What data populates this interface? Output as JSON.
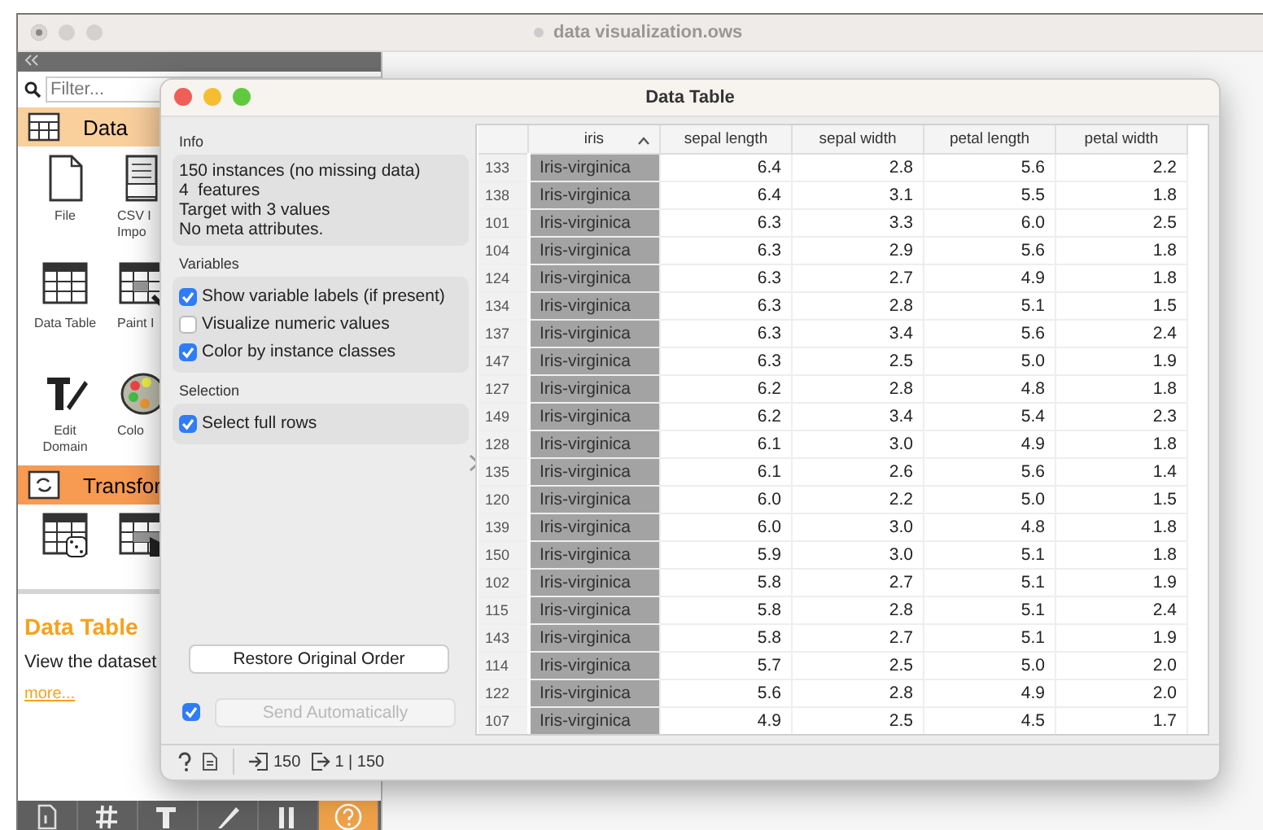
{
  "app_window": {
    "title": "data visualization.ows"
  },
  "sidebar": {
    "filter": {
      "placeholder": "Filter..."
    },
    "categories": [
      {
        "name": "Data",
        "color": "#f9cf9c",
        "kind": "data",
        "widgets": [
          {
            "kind": "file",
            "lines": [
              "File"
            ]
          },
          {
            "kind": "csv",
            "lines": [
              "CSV I",
              "Impo"
            ]
          },
          {
            "kind": "table",
            "lines": [
              "Data Table"
            ]
          },
          {
            "kind": "paint",
            "lines": [
              "Paint I"
            ]
          },
          {
            "kind": "edit",
            "lines": [
              "Edit",
              "Domain"
            ]
          },
          {
            "kind": "palette",
            "lines": [
              "Colo"
            ]
          }
        ]
      },
      {
        "name": "Transfor",
        "color": "#f79a52",
        "kind": "transform",
        "widgets": [
          {
            "kind": "sampler"
          },
          {
            "kind": "select"
          }
        ]
      }
    ],
    "help": {
      "title": "Data Table",
      "description": "View the dataset",
      "link": "more..."
    },
    "toolbar": [
      {
        "kind": "doc",
        "selected": false
      },
      {
        "kind": "hash",
        "selected": false
      },
      {
        "kind": "text",
        "selected": false
      },
      {
        "kind": "pen",
        "selected": false
      },
      {
        "kind": "pause",
        "selected": false
      },
      {
        "kind": "help",
        "selected": true
      }
    ]
  },
  "dialog": {
    "title": "Data Table",
    "info": {
      "heading": "Info",
      "lines": [
        "150 instances (no missing data)",
        "4  features",
        "Target with 3 values",
        "No meta attributes."
      ]
    },
    "variables": {
      "heading": "Variables",
      "options": [
        {
          "label": "Show variable labels (if present)",
          "checked": true
        },
        {
          "label": "Visualize numeric values",
          "checked": false
        },
        {
          "label": "Color by instance classes",
          "checked": true
        }
      ]
    },
    "selection": {
      "heading": "Selection",
      "options": [
        {
          "label": "Select full rows",
          "checked": true
        }
      ]
    },
    "restore_button": "Restore Original Order",
    "auto_send": {
      "checked": true,
      "label": "Send Automatically",
      "disabled": true
    },
    "status_bar": {
      "inputs": "150",
      "outputs": "1 | 150"
    },
    "table": {
      "columns": [
        {
          "label": "iris",
          "sorted": true
        },
        {
          "label": "sepal length",
          "sorted": false
        },
        {
          "label": "sepal width",
          "sorted": false
        },
        {
          "label": "petal length",
          "sorted": false
        },
        {
          "label": "petal width",
          "sorted": false
        }
      ],
      "rows": [
        {
          "index": "133",
          "cells": [
            "Iris-virginica",
            "6.4",
            "2.8",
            "5.6",
            "2.2"
          ]
        },
        {
          "index": "138",
          "cells": [
            "Iris-virginica",
            "6.4",
            "3.1",
            "5.5",
            "1.8"
          ]
        },
        {
          "index": "101",
          "cells": [
            "Iris-virginica",
            "6.3",
            "3.3",
            "6.0",
            "2.5"
          ]
        },
        {
          "index": "104",
          "cells": [
            "Iris-virginica",
            "6.3",
            "2.9",
            "5.6",
            "1.8"
          ]
        },
        {
          "index": "124",
          "cells": [
            "Iris-virginica",
            "6.3",
            "2.7",
            "4.9",
            "1.8"
          ]
        },
        {
          "index": "134",
          "cells": [
            "Iris-virginica",
            "6.3",
            "2.8",
            "5.1",
            "1.5"
          ]
        },
        {
          "index": "137",
          "cells": [
            "Iris-virginica",
            "6.3",
            "3.4",
            "5.6",
            "2.4"
          ]
        },
        {
          "index": "147",
          "cells": [
            "Iris-virginica",
            "6.3",
            "2.5",
            "5.0",
            "1.9"
          ]
        },
        {
          "index": "127",
          "cells": [
            "Iris-virginica",
            "6.2",
            "2.8",
            "4.8",
            "1.8"
          ]
        },
        {
          "index": "149",
          "cells": [
            "Iris-virginica",
            "6.2",
            "3.4",
            "5.4",
            "2.3"
          ]
        },
        {
          "index": "128",
          "cells": [
            "Iris-virginica",
            "6.1",
            "3.0",
            "4.9",
            "1.8"
          ]
        },
        {
          "index": "135",
          "cells": [
            "Iris-virginica",
            "6.1",
            "2.6",
            "5.6",
            "1.4"
          ]
        },
        {
          "index": "120",
          "cells": [
            "Iris-virginica",
            "6.0",
            "2.2",
            "5.0",
            "1.5"
          ]
        },
        {
          "index": "139",
          "cells": [
            "Iris-virginica",
            "6.0",
            "3.0",
            "4.8",
            "1.8"
          ]
        },
        {
          "index": "150",
          "cells": [
            "Iris-virginica",
            "5.9",
            "3.0",
            "5.1",
            "1.8"
          ]
        },
        {
          "index": "102",
          "cells": [
            "Iris-virginica",
            "5.8",
            "2.7",
            "5.1",
            "1.9"
          ]
        },
        {
          "index": "115",
          "cells": [
            "Iris-virginica",
            "5.8",
            "2.8",
            "5.1",
            "2.4"
          ]
        },
        {
          "index": "143",
          "cells": [
            "Iris-virginica",
            "5.8",
            "2.7",
            "5.1",
            "1.9"
          ]
        },
        {
          "index": "114",
          "cells": [
            "Iris-virginica",
            "5.7",
            "2.5",
            "5.0",
            "2.0"
          ]
        },
        {
          "index": "122",
          "cells": [
            "Iris-virginica",
            "5.6",
            "2.8",
            "4.9",
            "2.0"
          ]
        },
        {
          "index": "107",
          "cells": [
            "Iris-virginica",
            "4.9",
            "2.5",
            "4.5",
            "1.7"
          ]
        }
      ]
    }
  }
}
